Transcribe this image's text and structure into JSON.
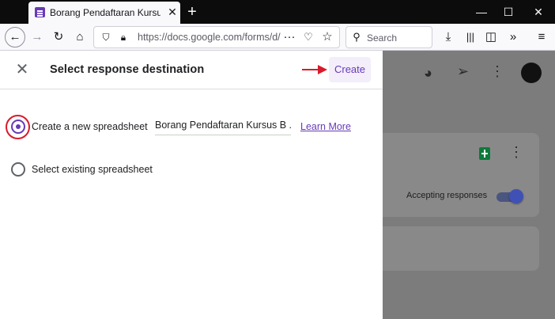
{
  "browser": {
    "tab_title": "Borang Pendaftaran Kursus Ben",
    "url": "https://docs.google.com/forms/d/",
    "search_placeholder": "Search"
  },
  "dialog": {
    "title": "Select response destination",
    "create_label": "Create",
    "option_new_label": "Create a new spreadsheet",
    "new_sheet_name": "Borang Pendaftaran Kursus B ...",
    "learn_more_label": "Learn More",
    "option_existing_label": "Select existing spreadsheet",
    "selected_option": "Create a new spreadsheet"
  },
  "background": {
    "accepting_label": "Accepting responses",
    "accepting_on": true
  },
  "colors": {
    "accent": "#673ab7",
    "annotation": "#d81b2a",
    "overlay": "#7d7c7d"
  }
}
